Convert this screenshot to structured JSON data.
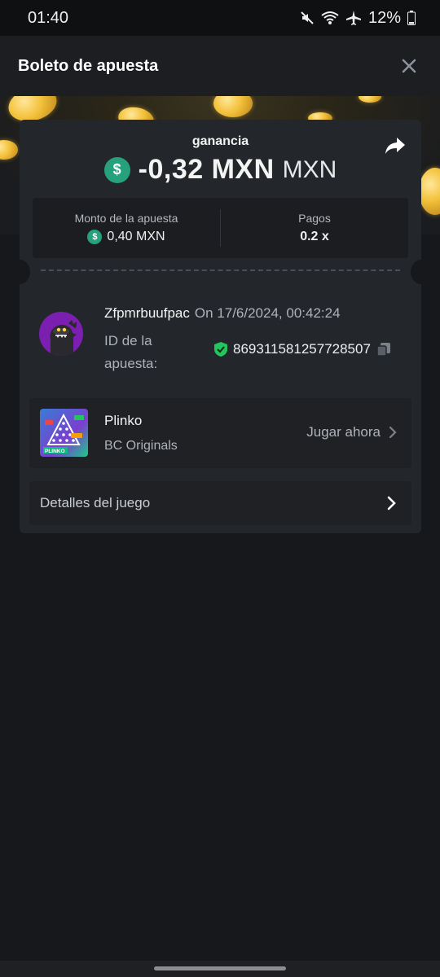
{
  "status_bar": {
    "time": "01:40",
    "battery": "12%"
  },
  "header": {
    "title": "Boleto de apuesta"
  },
  "result": {
    "label": "ganancia",
    "amount": "-0,32 MXN",
    "currency": "MXN",
    "icon": "dollar-icon"
  },
  "stats": {
    "bet_amount_label": "Monto de la apuesta",
    "bet_amount_value": "0,40 MXN",
    "payout_label": "Pagos",
    "payout_value": "0.2 x"
  },
  "bet": {
    "username": "Zfpmrbuufpac",
    "date": "On 17/6/2024, 00:42:24",
    "id_label": "ID de la apuesta:",
    "id_value": "869311581257728507"
  },
  "game": {
    "name": "Plinko",
    "provider": "BC Originals",
    "play_label": "Jugar ahora"
  },
  "details": {
    "label": "Detalles del juego"
  },
  "colors": {
    "accent_green": "#26a17b",
    "background": "#17181b",
    "card": "#23262b",
    "avatar": "#7b1fb0"
  }
}
